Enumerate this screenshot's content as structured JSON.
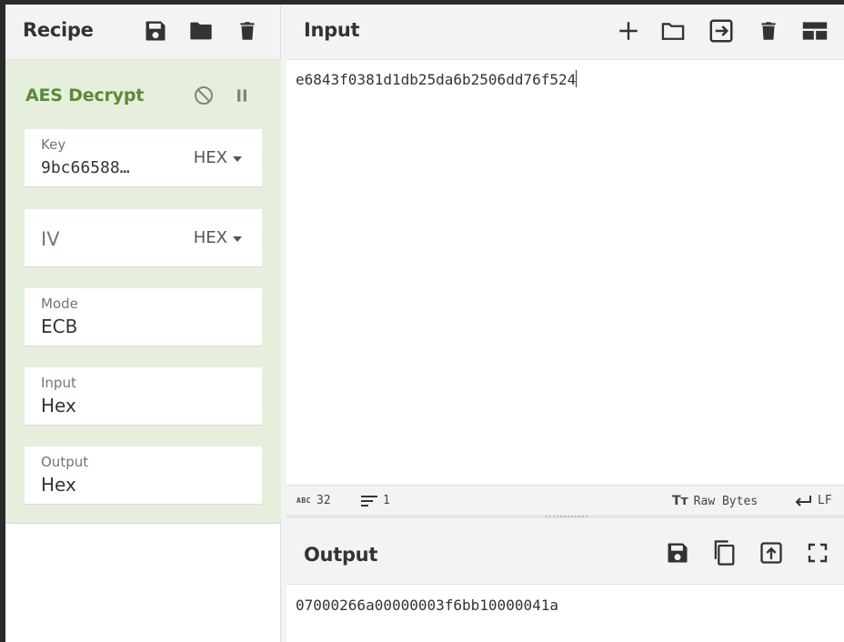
{
  "recipe": {
    "title": "Recipe",
    "operation": {
      "name": "AES Decrypt",
      "key": {
        "label": "Key",
        "value": "9bc66588…",
        "format": "HEX"
      },
      "iv": {
        "label": "IV",
        "value": "",
        "format": "HEX"
      },
      "mode": {
        "label": "Mode",
        "value": "ECB"
      },
      "input": {
        "label": "Input",
        "value": "Hex"
      },
      "output": {
        "label": "Output",
        "value": "Hex"
      }
    }
  },
  "input_pane": {
    "title": "Input",
    "text": "e6843f0381d1db25da6b2506dd76f524",
    "status": {
      "abc_icon_text": "ABC",
      "char_count": "32",
      "line_count": "1",
      "tt_icon_text": "Tт",
      "encoding": "Raw Bytes",
      "eol": "LF"
    }
  },
  "output_pane": {
    "title": "Output",
    "text": "07000266a00000003f6bb10000041a"
  },
  "colors": {
    "accent_green": "#5a8a3a",
    "operation_bg": "#e5efdb",
    "icon_dark": "#333333"
  }
}
